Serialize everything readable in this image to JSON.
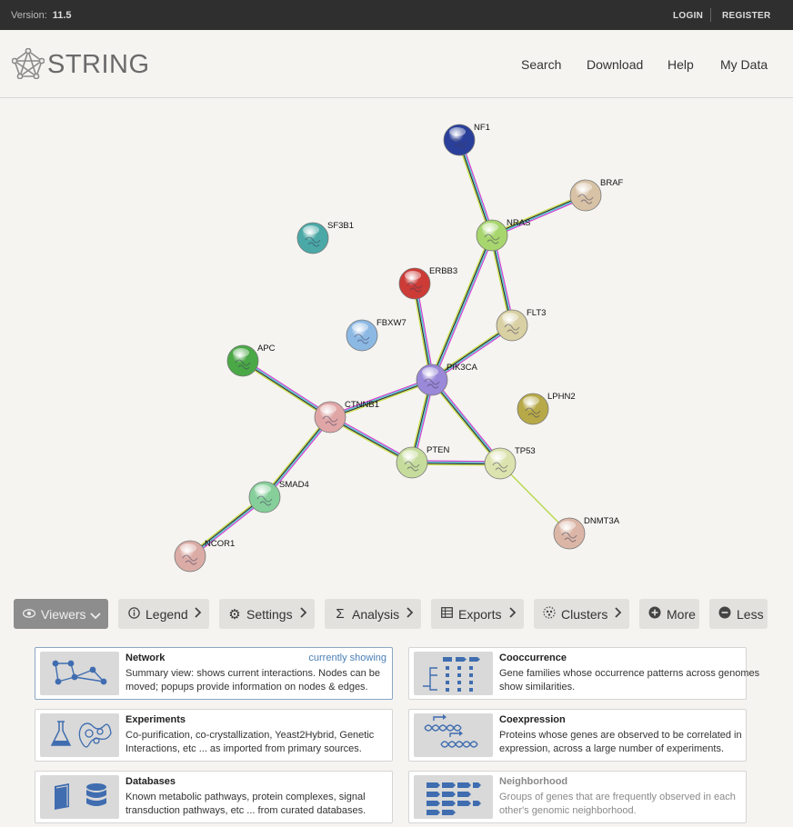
{
  "topbar": {
    "version_label": "Version:",
    "version_value": "11.5",
    "login": "LOGIN",
    "register": "REGISTER"
  },
  "header": {
    "logo": "STRING",
    "nav": [
      "Search",
      "Download",
      "Help",
      "My Data"
    ]
  },
  "network": {
    "nodes": [
      {
        "id": "NF1",
        "color": "#2a3f9a"
      },
      {
        "id": "BRAF",
        "color": "#d8c2a6"
      },
      {
        "id": "SF3B1",
        "color": "#4aa9a6"
      },
      {
        "id": "NRAS",
        "color": "#a8d66e"
      },
      {
        "id": "ERBB3",
        "color": "#cc3b36"
      },
      {
        "id": "FLT3",
        "color": "#d9d0a3"
      },
      {
        "id": "FBXW7",
        "color": "#8cb8e4"
      },
      {
        "id": "APC",
        "color": "#4aa846"
      },
      {
        "id": "PIK3CA",
        "color": "#9a88d8"
      },
      {
        "id": "LPHN2",
        "color": "#b7a948"
      },
      {
        "id": "CTNNB1",
        "color": "#e0a6a6"
      },
      {
        "id": "PTEN",
        "color": "#c6dc9c"
      },
      {
        "id": "TP53",
        "color": "#dce3ae"
      },
      {
        "id": "SMAD4",
        "color": "#86cf9a"
      },
      {
        "id": "DNMT3A",
        "color": "#dbb6a6"
      },
      {
        "id": "NCOR1",
        "color": "#dbaca6"
      }
    ],
    "edges": [
      [
        "NF1",
        "NRAS"
      ],
      [
        "BRAF",
        "NRAS"
      ],
      [
        "NRAS",
        "FLT3"
      ],
      [
        "NRAS",
        "PIK3CA"
      ],
      [
        "ERBB3",
        "PIK3CA"
      ],
      [
        "FLT3",
        "PIK3CA"
      ],
      [
        "APC",
        "CTNNB1"
      ],
      [
        "CTNNB1",
        "PIK3CA"
      ],
      [
        "CTNNB1",
        "PTEN"
      ],
      [
        "CTNNB1",
        "SMAD4"
      ],
      [
        "PIK3CA",
        "PTEN"
      ],
      [
        "PIK3CA",
        "TP53"
      ],
      [
        "PTEN",
        "TP53"
      ],
      [
        "SMAD4",
        "NCOR1"
      ],
      [
        "TP53",
        "DNMT3A"
      ]
    ]
  },
  "toolbar": {
    "viewers": "Viewers",
    "legend": "Legend",
    "settings": "Settings",
    "analysis": "Analysis",
    "exports": "Exports",
    "clusters": "Clusters",
    "more": "More",
    "less": "Less"
  },
  "viewers": [
    {
      "title": "Network",
      "badge": "currently showing",
      "desc": "Summary view: shows current interactions. Nodes can be moved; popups provide information on nodes & edges."
    },
    {
      "title": "Cooccurrence",
      "desc": "Gene families whose occurrence patterns across genomes show similarities."
    },
    {
      "title": "Experiments",
      "desc": "Co-purification, co-crystallization, Yeast2Hybrid, Genetic Interactions, etc ... as imported from primary sources."
    },
    {
      "title": "Coexpression",
      "desc": "Proteins whose genes are observed to be correlated in expression, across a large number of experiments."
    },
    {
      "title": "Databases",
      "desc": "Known metabolic pathways, protein complexes, signal transduction pathways, etc ... from curated databases."
    },
    {
      "title": "Neighborhood",
      "desc": "Groups of genes that are frequently observed in each other's genomic neighborhood."
    }
  ]
}
